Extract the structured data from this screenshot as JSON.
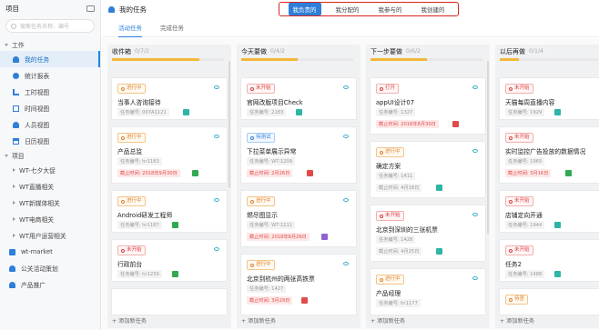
{
  "sidebar": {
    "header": "项目",
    "search_placeholder": "搜索任务名称、编号",
    "section_work": "工作",
    "work_items": [
      "我的任务",
      "统计报表",
      "工时视图",
      "时间视图",
      "人员视图",
      "日历视图"
    ],
    "section_project": "项目",
    "projects": [
      "WT-七夕大促",
      "WT直播相关",
      "WT新媒体相关",
      "WT电商相关",
      "WT用户运营相关",
      "wt-market",
      "公关活动策划",
      "产品推广"
    ]
  },
  "topbar": {
    "title": "我的任务",
    "view_tabs": [
      "我负责的",
      "我分配的",
      "我参与的",
      "我创建的"
    ],
    "active_view": "我负责的"
  },
  "subtabs": [
    "活动任务",
    "完成任务"
  ],
  "columns": [
    {
      "title": "收件箱",
      "count": "0/7/2",
      "progress": 0.78,
      "cards": [
        {
          "status": "进行中",
          "title": "当事人咨询接待",
          "id": "任务编号: 007A1121"
        },
        {
          "status": "进行中",
          "title": "产品总监",
          "id": "任务编号: hr1183",
          "due": "截止时间: 2018年9月30日"
        },
        {
          "status": "进行中",
          "title": "Android研发工程师",
          "id": "任务编号: hr1187"
        },
        {
          "status": "未开始",
          "title": "行政前台",
          "id": "任务编号: hr1239"
        }
      ]
    },
    {
      "title": "今天要做",
      "count": "0/4/2",
      "progress": 0.5,
      "cards": [
        {
          "status": "未开始",
          "title": "官网改版项目Check",
          "id": "任务编号: 2183"
        },
        {
          "status": "待测试",
          "title": "下拉菜单展示异常",
          "id": "任务编号: WT-1209",
          "due": "截止时间: 2月26日"
        },
        {
          "status": "进行中",
          "title": "燃尽图显示",
          "id": "任务编号: WT-1211",
          "due": "截止时间: 2018年8月26日"
        },
        {
          "status": "进行中",
          "title": "北京到杭州的两张高铁票",
          "id": "任务编号: 1427",
          "due": "截止时间: 3月29日"
        }
      ]
    },
    {
      "title": "下一步要做",
      "count": "0/6/2",
      "progress": 0.5,
      "cards": [
        {
          "status": "打开",
          "title": "appUI设计07",
          "id": "任务编号: 1327",
          "due": "截止时间: 2018年8月30日"
        },
        {
          "status": "进行中",
          "title": "确定方案",
          "id": "任务编号: 1411",
          "plain_due": "截止时间: 4月18日"
        },
        {
          "status": "未开始",
          "title": "北京到深圳的三张机票",
          "id": "任务编号: 1428",
          "plain_due": "截止时间: 4月25日"
        },
        {
          "status": "进行中",
          "title": "产品经理",
          "id": "任务编号: hr1177"
        }
      ]
    },
    {
      "title": "以后再做",
      "count": "0/1/4",
      "progress": 0.2,
      "cards": [
        {
          "status": "未开始",
          "title": "天猫每周直播内容",
          "id": "任务编号: 1929"
        },
        {
          "status": "未开始",
          "title": "实时监控广告投放的数据情况",
          "id": "任务编号: 1965",
          "due": "截止时间: 3月16日"
        },
        {
          "status": "未开始",
          "title": "店铺定向开通",
          "id": "任务编号: 1944"
        },
        {
          "status": "未开始",
          "title": "任务2",
          "id": "任务编号: 1488"
        },
        {
          "status": "待查"
        }
      ]
    }
  ],
  "add_task_label": "+ 添加新任务",
  "colors": {
    "accent": "#2e7fd9",
    "highlight_box": "#d9251d",
    "progress": "#f3b73a"
  }
}
